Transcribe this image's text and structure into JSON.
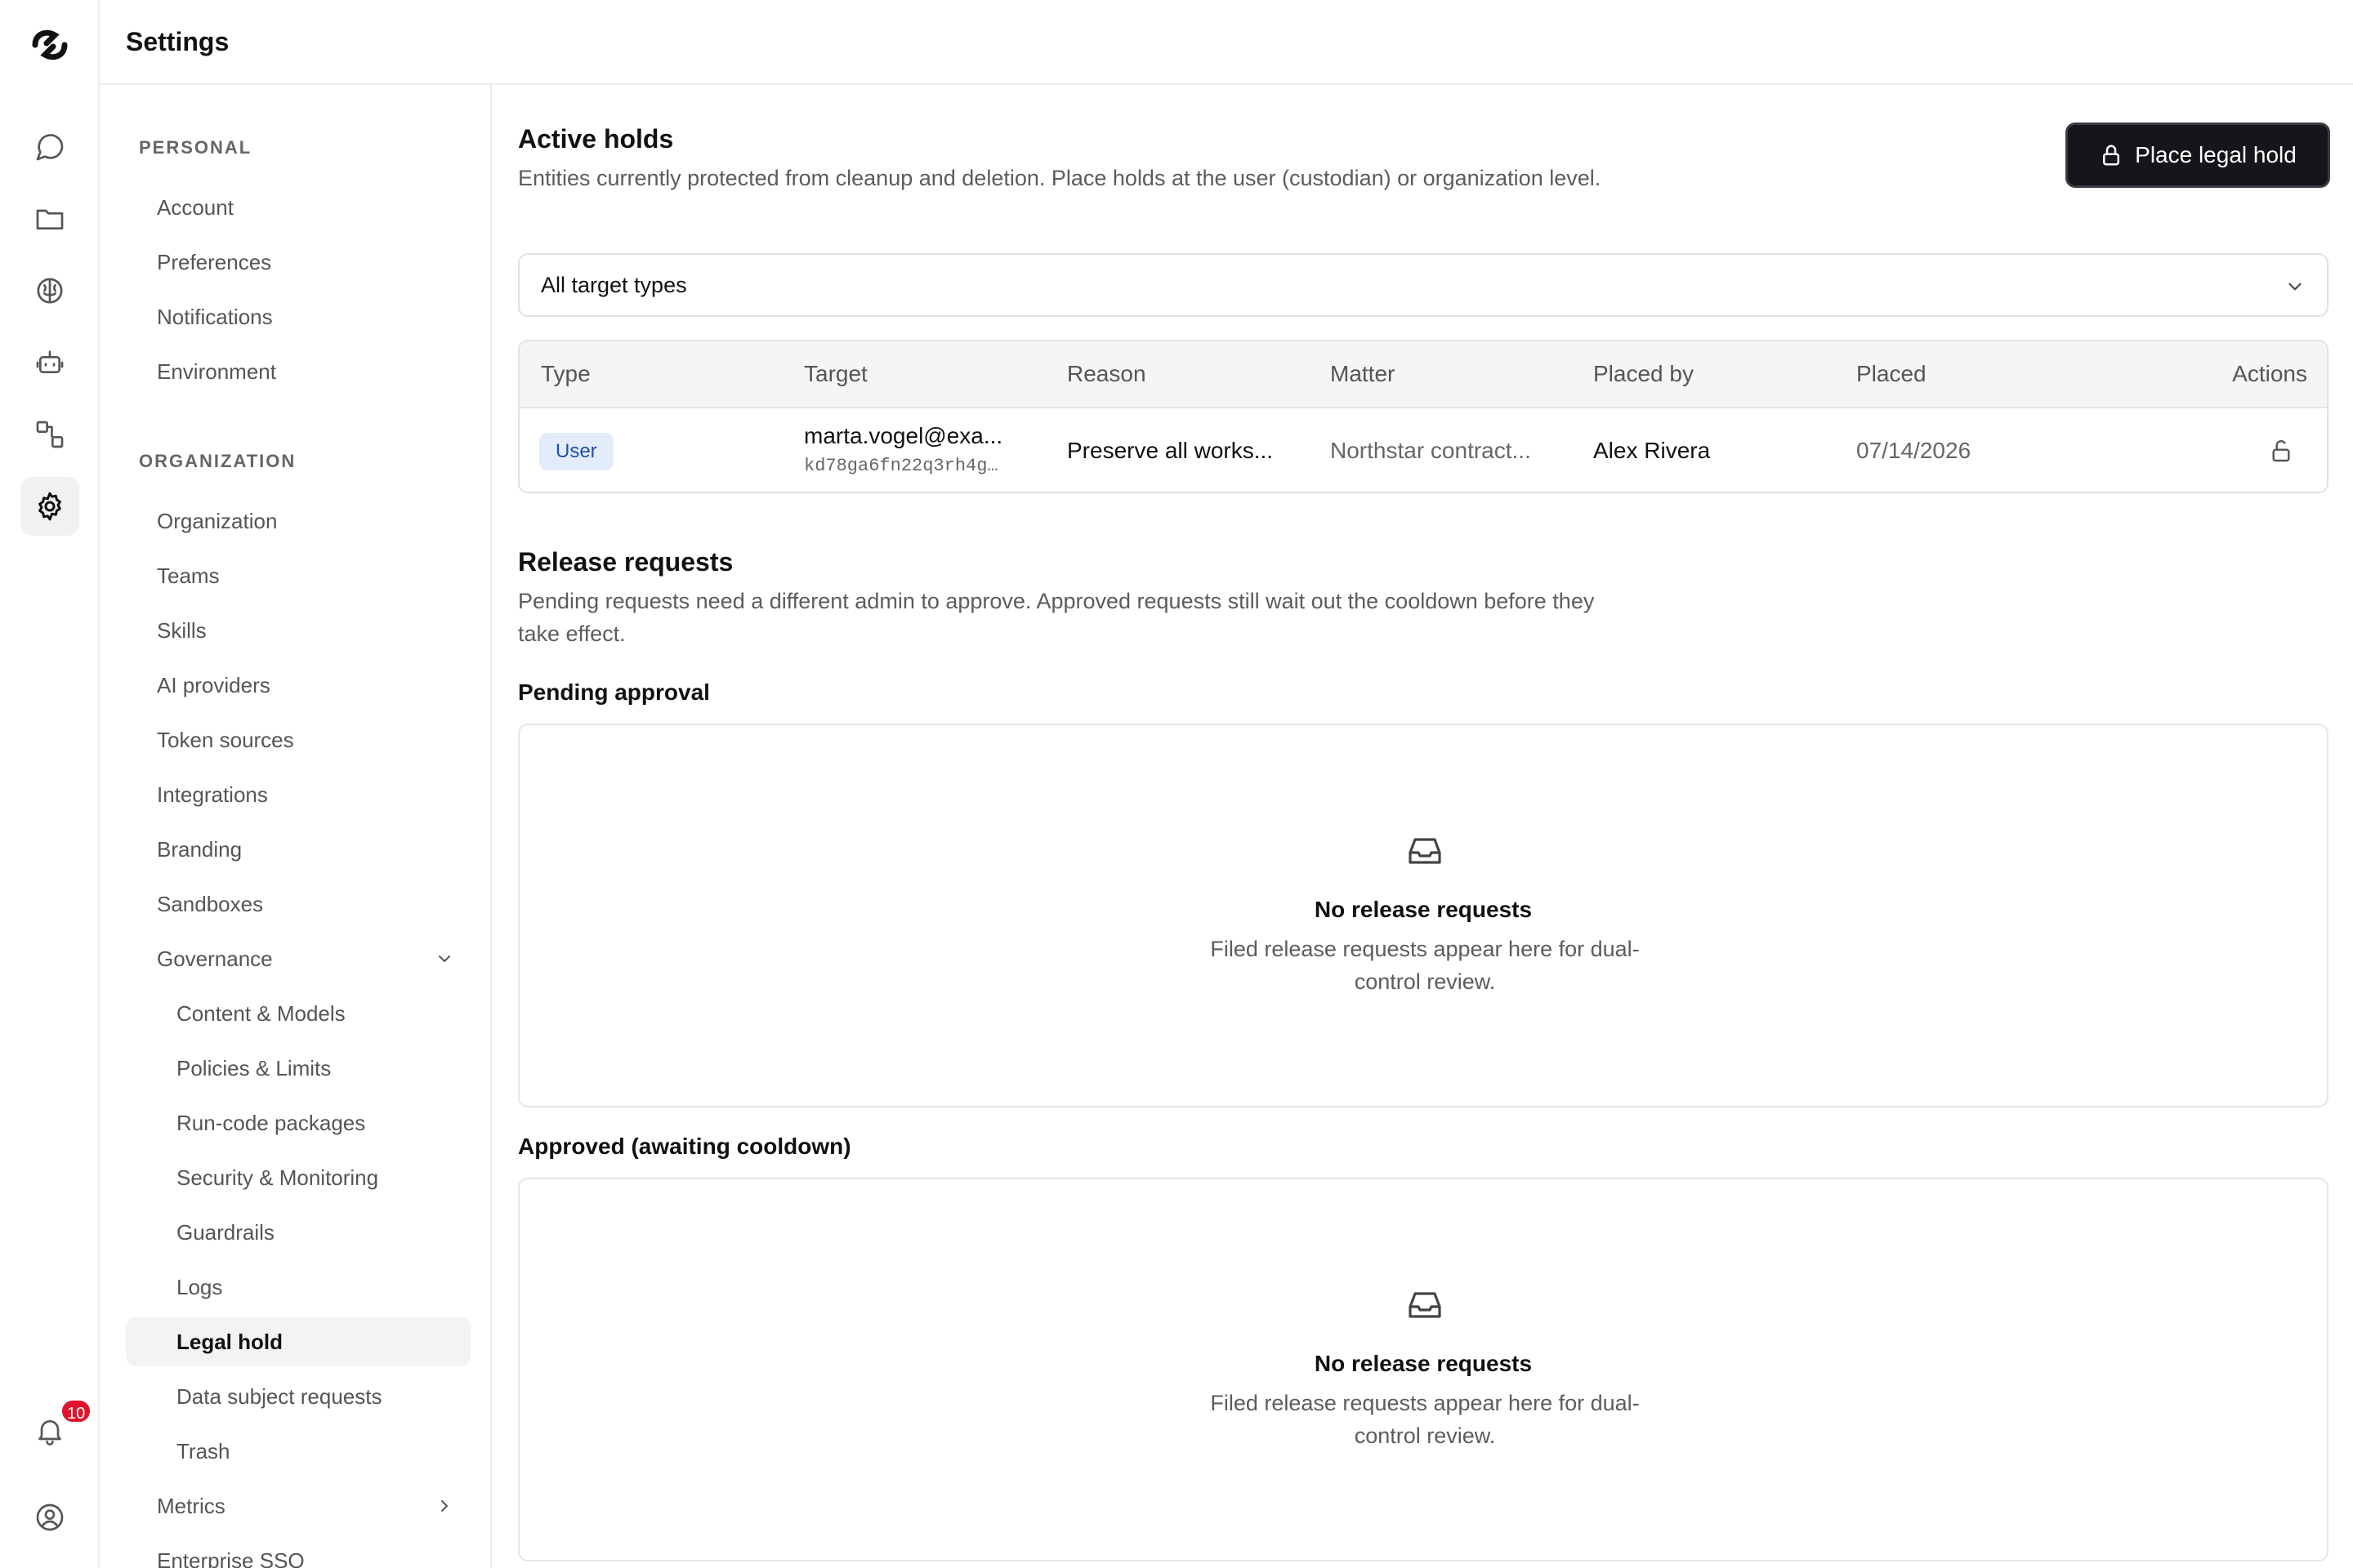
{
  "header": {
    "title": "Settings"
  },
  "rail": {
    "items": [
      {
        "icon": "chat-bubble-icon"
      },
      {
        "icon": "folder-icon"
      },
      {
        "icon": "brain-icon"
      },
      {
        "icon": "robot-icon"
      },
      {
        "icon": "workflow-icon"
      },
      {
        "icon": "gear-icon",
        "active": true
      }
    ],
    "notifications_count": "10"
  },
  "nav": {
    "personal_label": "PERSONAL",
    "personal": [
      "Account",
      "Preferences",
      "Notifications",
      "Environment"
    ],
    "organization_label": "ORGANIZATION",
    "organization": [
      "Organization",
      "Teams",
      "Skills",
      "AI providers",
      "Token sources",
      "Integrations",
      "Branding",
      "Sandboxes"
    ],
    "governance": "Governance",
    "governance_items": [
      "Content & Models",
      "Policies & Limits",
      "Run-code packages",
      "Security & Monitoring",
      "Guardrails",
      "Logs",
      "Legal hold",
      "Data subject requests",
      "Trash"
    ],
    "metrics": "Metrics",
    "enterprise_sso": "Enterprise SSO",
    "active": "Legal hold"
  },
  "active_holds": {
    "title": "Active holds",
    "description": "Entities currently protected from cleanup and deletion. Place holds at the user (custodian) or organization level.",
    "button": "Place legal hold",
    "filter_value": "All target types",
    "columns": [
      "Type",
      "Target",
      "Reason",
      "Matter",
      "Placed by",
      "Placed",
      "Actions"
    ],
    "rows": [
      {
        "type": "User",
        "target": "marta.vogel@exa...",
        "target_id": "kd78ga6fn22q3rh4g…",
        "reason": "Preserve all works...",
        "matter": "Northstar contract...",
        "placed_by": "Alex Rivera",
        "placed": "07/14/2026"
      }
    ]
  },
  "release_requests": {
    "title": "Release requests",
    "description": "Pending requests need a different admin to approve. Approved requests still wait out the cooldown before they take effect.",
    "pending_label": "Pending approval",
    "approved_label": "Approved (awaiting cooldown)",
    "empty_title": "No release requests",
    "empty_desc": "Filed release requests appear here for dual-control review."
  },
  "colors": {
    "primary": "#15161a",
    "badge": "#e0142b",
    "pill_bg": "#e3ecfb",
    "pill_text": "#1d4fa8"
  }
}
